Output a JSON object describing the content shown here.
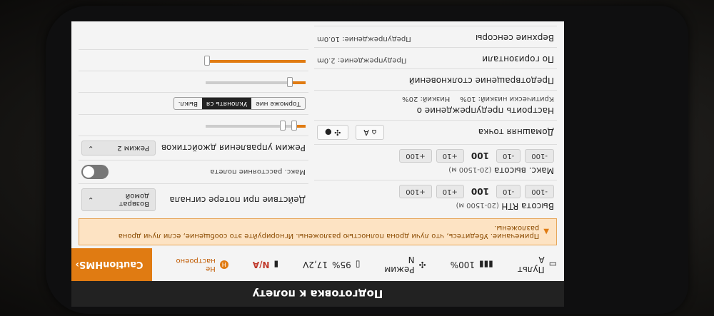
{
  "title": "Подготовка к полету",
  "status": {
    "remote": "Пульт А",
    "signal_pct": "100%",
    "mode": "Режим N",
    "battery": "95%",
    "voltage": "17,2V",
    "gps": "N/A",
    "hms_note_line1": "Не",
    "hms_note_line2": "настроено",
    "caution_label": "Caution",
    "hms_label": "HMS"
  },
  "notice": {
    "text": "Примечание. Убедитесь, что лучи дрона полностью разложены. Игнорируйте это сообщение, если лучи дрона разложены."
  },
  "left": {
    "rth_height": {
      "title": "Высота RTH",
      "range": "(20-1500 м)",
      "minus100": "-100",
      "minus10": "-10",
      "value": "100",
      "plus10": "+10",
      "plus100": "+100"
    },
    "max_height": {
      "title": "Макс. высота",
      "range": "(20-1500 м)",
      "minus100": "-100",
      "minus10": "-10",
      "value": "100",
      "plus10": "+10",
      "plus100": "+100"
    },
    "home_point": {
      "title": "Домашняя точка"
    },
    "warning": {
      "title": "Настроить предупреждение о",
      "critical": "Критически низкий: 10%",
      "low": "Низкий: 20%"
    },
    "avoidance": {
      "title": "Предотвращение столкновений"
    },
    "horizontal": {
      "title": "По горизонтали",
      "warning": "Предупреждение: 2.0m"
    },
    "upper": {
      "title": "Верхние сенсоры",
      "warning": "Предупреждение: 10.0m"
    }
  },
  "right": {
    "signal_loss": {
      "title": "Действие при потере сигнала",
      "value": "Возврат домой"
    },
    "max_distance": {
      "title": "Макс. расстояние полета"
    },
    "joystick": {
      "title": "Режим управления джойстиков",
      "value": "Режим 2"
    },
    "avoid_opts": [
      "Торможе ние",
      "Уклонять ся",
      "Выкл."
    ]
  },
  "colors": {
    "accent": "#e07b12",
    "notice_bg": "#fde3c3"
  },
  "sliders": {
    "warning_critical_pct": 10,
    "warning_low_pct": 20,
    "horizontal_pct": 15,
    "upper_pct": 100
  }
}
